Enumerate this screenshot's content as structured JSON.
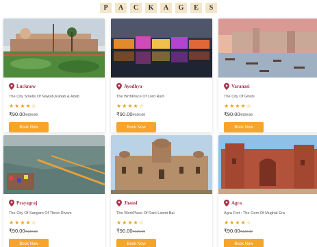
{
  "header": {
    "letters": [
      "P",
      "A",
      "C",
      "K",
      "A",
      "G",
      "E",
      "S"
    ]
  },
  "packages": [
    {
      "city": "Lucknow",
      "desc": "The City Smells Of Nawab,Kabab & Adab",
      "rating": 4,
      "price": "₹90.00",
      "old_price": "₹120.00",
      "button": "Book Now",
      "icon": "map-pin-icon"
    },
    {
      "city": "Ayodhya",
      "desc": "The BirthPlace Of Lord Ram",
      "rating": 4,
      "price": "₹90.00",
      "old_price": "₹120.00",
      "button": "Book Now",
      "icon": "map-pin-icon"
    },
    {
      "city": "Varanasi",
      "desc": "The City Of Ghats",
      "rating": 4,
      "price": "₹90.00",
      "old_price": "₹120.00",
      "button": "Book Now",
      "icon": "map-pin-icon"
    },
    {
      "city": "Prayagraj",
      "desc": "The City Of Sangam Of Three Rivers",
      "rating": 4,
      "price": "₹90.00",
      "old_price": "₹120.00",
      "button": "Book Now",
      "icon": "map-pin-icon"
    },
    {
      "city": "Jhansi",
      "desc": "The WorkPlace Of Rani Laxmi Bai",
      "rating": 4,
      "price": "₹90.00",
      "old_price": "₹120.00",
      "button": "Book Now",
      "icon": "map-pin-icon"
    },
    {
      "city": "Agra",
      "desc": "Agra Fort : The Gem Of Mughal Era",
      "rating": 4,
      "price": "₹90.00",
      "old_price": "₹120.00",
      "button": "Book Now",
      "icon": "map-pin-icon"
    }
  ],
  "colors": {
    "accent": "#f4a52a",
    "city": "#a83248",
    "star": "#e9a11a",
    "heading_tile": "#f3e6c9"
  }
}
